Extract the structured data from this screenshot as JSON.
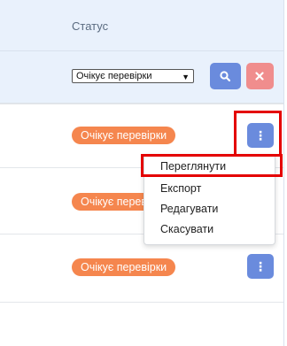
{
  "table": {
    "status_header": "Статус",
    "filter": {
      "status_selected": "Очікує перевірки"
    },
    "rows": [
      {
        "status": "Очікує перевірки"
      },
      {
        "status": "Очікує перевірки"
      },
      {
        "status": "Очікує перевірки"
      }
    ]
  },
  "dropdown": {
    "items": [
      "Переглянути",
      "Експорт",
      "Редагувати",
      "Скасувати"
    ]
  },
  "icons": {
    "search": "search-icon",
    "clear": "close-icon",
    "actions": "kebab-menu-icon"
  },
  "colors": {
    "header_bg": "#e9f1fc",
    "badge": "#f5864e",
    "primary_button": "#6a8bdd",
    "danger_button": "#f08d8d",
    "highlight": "#e40000"
  }
}
